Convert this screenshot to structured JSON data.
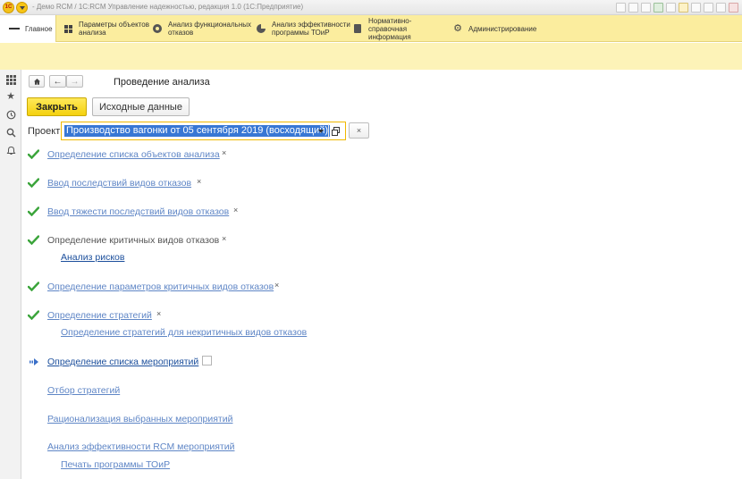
{
  "window": {
    "title": "- Демо RCM / 1С:RCM Управление надежностью, редакция 1.0  (1С:Предприятие)"
  },
  "sections": [
    {
      "label": "Главное",
      "icon": "menu-icon",
      "active": true
    },
    {
      "label": "Параметры объектов анализа",
      "icon": "grid-icon"
    },
    {
      "label": "Анализ функциональных отказов",
      "icon": "target-icon"
    },
    {
      "label": "Анализ эффективности программы ТОиР",
      "icon": "pie-chart-icon"
    },
    {
      "label": "Нормативно-справочная информация",
      "icon": "book-icon"
    },
    {
      "label": "Администрирование",
      "icon": "gear-icon"
    }
  ],
  "page": {
    "title": "Проведение анализа",
    "close_button": "Закрыть",
    "source_button": "Исходные данные",
    "project_label": "Проект:",
    "project_value": "Производство вагонки от 05 сентября 2019 (восходящий)",
    "clear_button": "×"
  },
  "steps": [
    {
      "label": "Определение списка объектов анализа",
      "status": "done",
      "removable": true
    },
    {
      "label": "Ввод последствий видов отказов",
      "status": "done",
      "removable": true
    },
    {
      "label": "Ввод тяжести последствий видов отказов",
      "status": "done",
      "removable": true
    },
    {
      "label": "Определение критичных видов отказов",
      "status": "done",
      "removable": true,
      "sublink": "Анализ рисков"
    },
    {
      "label": "Определение параметров критичных видов отказов",
      "status": "done",
      "removable": true
    },
    {
      "label": "Определение стратегий",
      "status": "done",
      "removable": true,
      "sublink": "Определение стратегий для некритичных видов отказов"
    },
    {
      "label": "Определение списка мероприятий",
      "status": "current"
    },
    {
      "label": "Отбор стратегий",
      "status": "pending"
    },
    {
      "label": "Рационализация выбранных мероприятий",
      "status": "pending"
    },
    {
      "label": "Анализ эффективности RCM мероприятий",
      "status": "pending",
      "sublink": "Печать программы ТОиР"
    }
  ],
  "colors": {
    "sections_bg": "#fbed9e",
    "accent_button": "#f4d10e",
    "link": "#5f86c6",
    "check": "#3aa43a"
  }
}
